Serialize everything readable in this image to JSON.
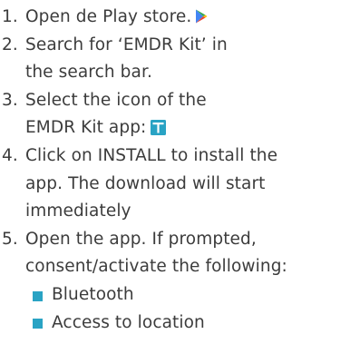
{
  "colors": {
    "text": "#3c3c3c",
    "accent": "#29a3c4",
    "play_green": "#34a853",
    "play_yellow": "#fbbc04",
    "play_red": "#ea4335",
    "play_blue": "#4285f4"
  },
  "steps": [
    {
      "number": "1.",
      "lines": [
        "Open de Play store."
      ],
      "icon": "play-store-icon"
    },
    {
      "number": "2.",
      "lines": [
        "Search for ‘EMDR Kit’ in",
        "the search bar."
      ]
    },
    {
      "number": "3.",
      "lines": [
        "Select the icon of the",
        "EMDR Kit app:"
      ],
      "icon": "emdr-kit-app-icon"
    },
    {
      "number": "4.",
      "lines": [
        "Click on INSTALL to install the",
        "app. The download will start",
        "immediately"
      ]
    },
    {
      "number": "5.",
      "lines": [
        "Open the app. If prompted,",
        "consent/activate the following:"
      ],
      "bullets": [
        "Bluetooth",
        "Access to location"
      ]
    }
  ]
}
